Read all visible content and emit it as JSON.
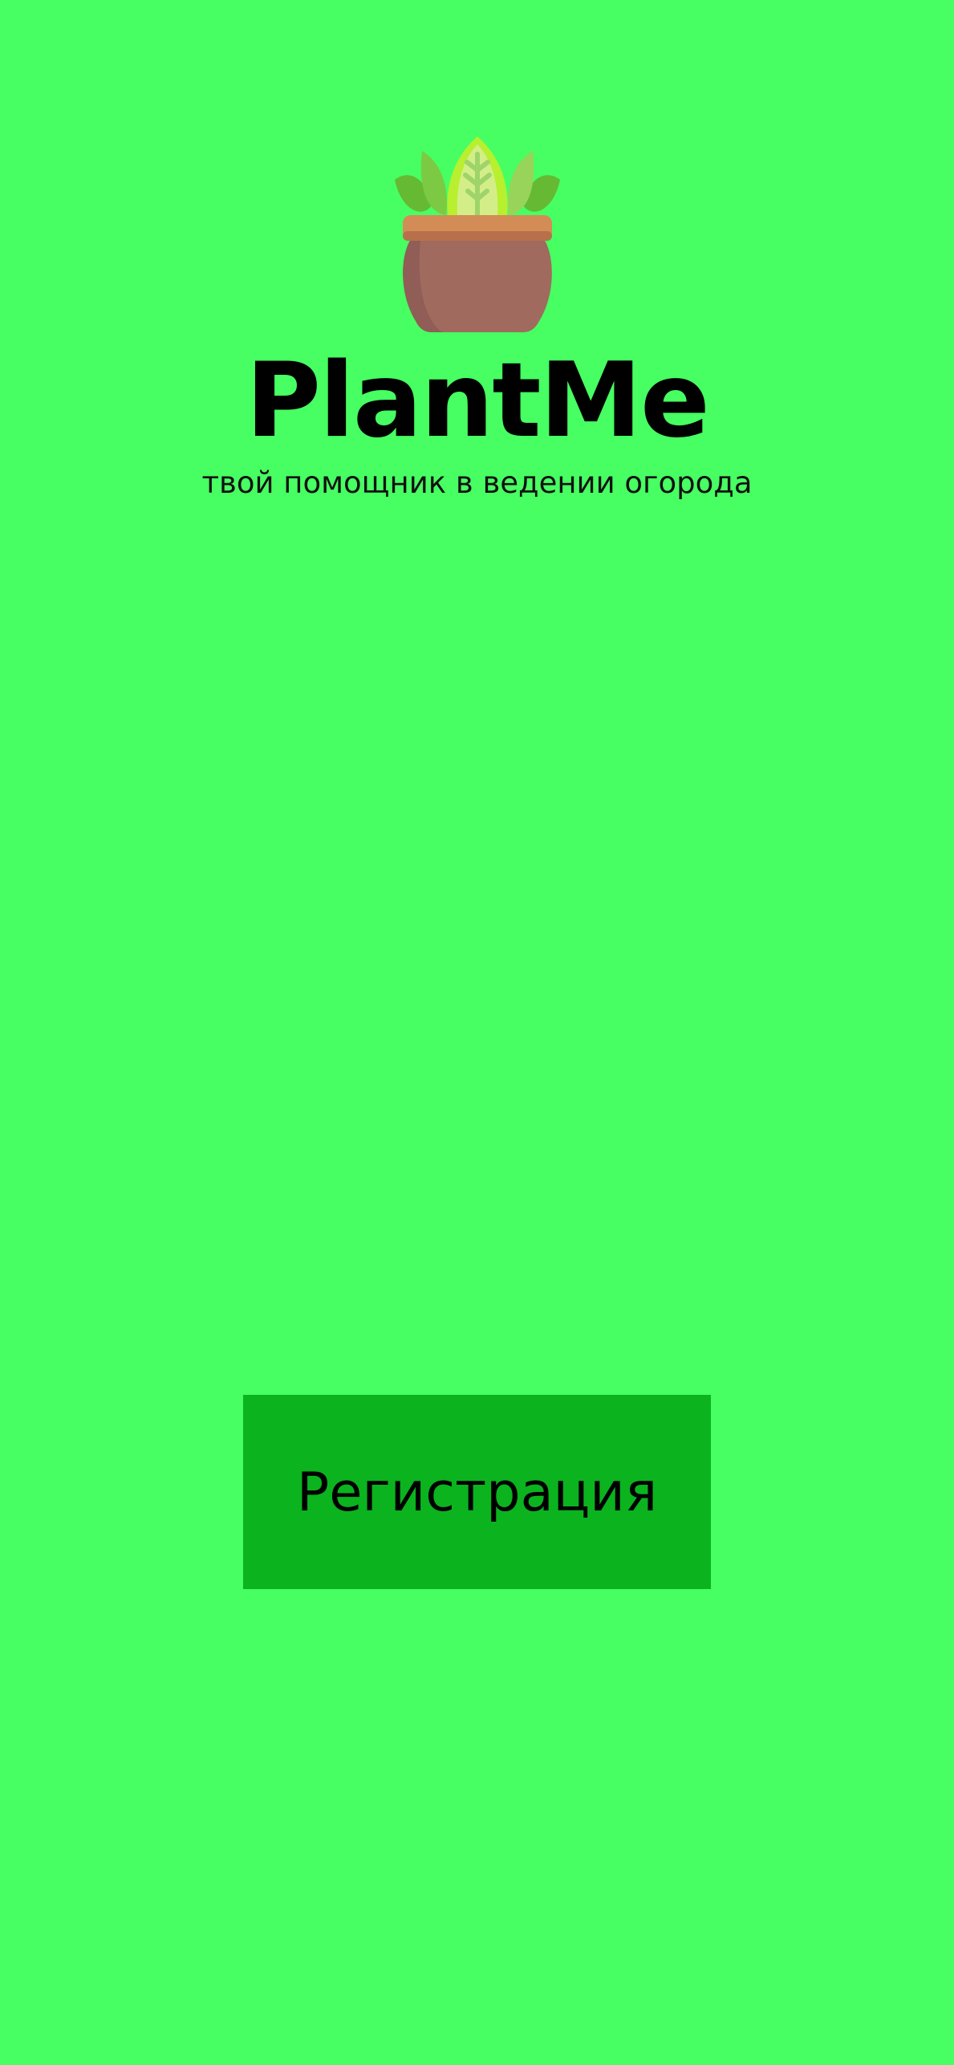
{
  "app": {
    "title": "PlantMe",
    "subtitle": "твой помощник в ведении огорода"
  },
  "logo": {
    "icon": "potted-plant-icon"
  },
  "actions": {
    "register_label": "Регистрация"
  },
  "colors": {
    "background": "#47FF62",
    "button": "#0BB31F",
    "text": "#000000"
  }
}
